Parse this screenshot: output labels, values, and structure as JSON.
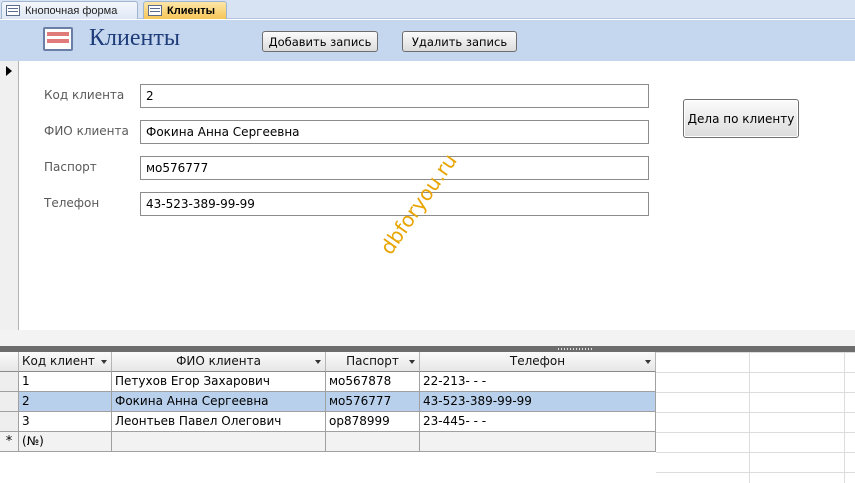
{
  "tabs": [
    {
      "label": "Кнопочная форма",
      "icon": "form-icon",
      "active": false
    },
    {
      "label": "Клиенты",
      "icon": "form-icon",
      "active": true
    }
  ],
  "header": {
    "title": "Клиенты",
    "add_button": "Добавить запись",
    "delete_button": "Удалить запись"
  },
  "form": {
    "fields": [
      {
        "label": "Код клиента",
        "value": "2"
      },
      {
        "label": "ФИО клиента",
        "value": "Фокина Анна Сергеевна"
      },
      {
        "label": "Паспорт",
        "value": "мо576777"
      },
      {
        "label": "Телефон",
        "value": "43-523-389-99-99"
      }
    ],
    "cases_button": "Дела по клиенту"
  },
  "watermark": "dbforyou.ru",
  "datasheet": {
    "columns": [
      "Код клиент",
      "ФИО клиента",
      "Паспорт",
      "Телефон"
    ],
    "rows": [
      [
        "1",
        "Петухов Егор Захарович",
        "мо567878",
        "22-213-   -   -"
      ],
      [
        "2",
        "Фокина Анна Сергеевна",
        "мо576777",
        "43-523-389-99-99"
      ],
      [
        "3",
        "Леонтьев Павел Олегович",
        "ор878999",
        "23-445-   -   -"
      ]
    ],
    "new_row_marker": "*",
    "new_row_placeholder": "(№)",
    "selected_row_index": 1
  },
  "colors": {
    "header_bg": "#c5d7ee",
    "title_color": "#1f3d7a",
    "active_tab": "#f6c658",
    "selected_row": "#b8d0ec",
    "watermark": "#e8a400"
  }
}
